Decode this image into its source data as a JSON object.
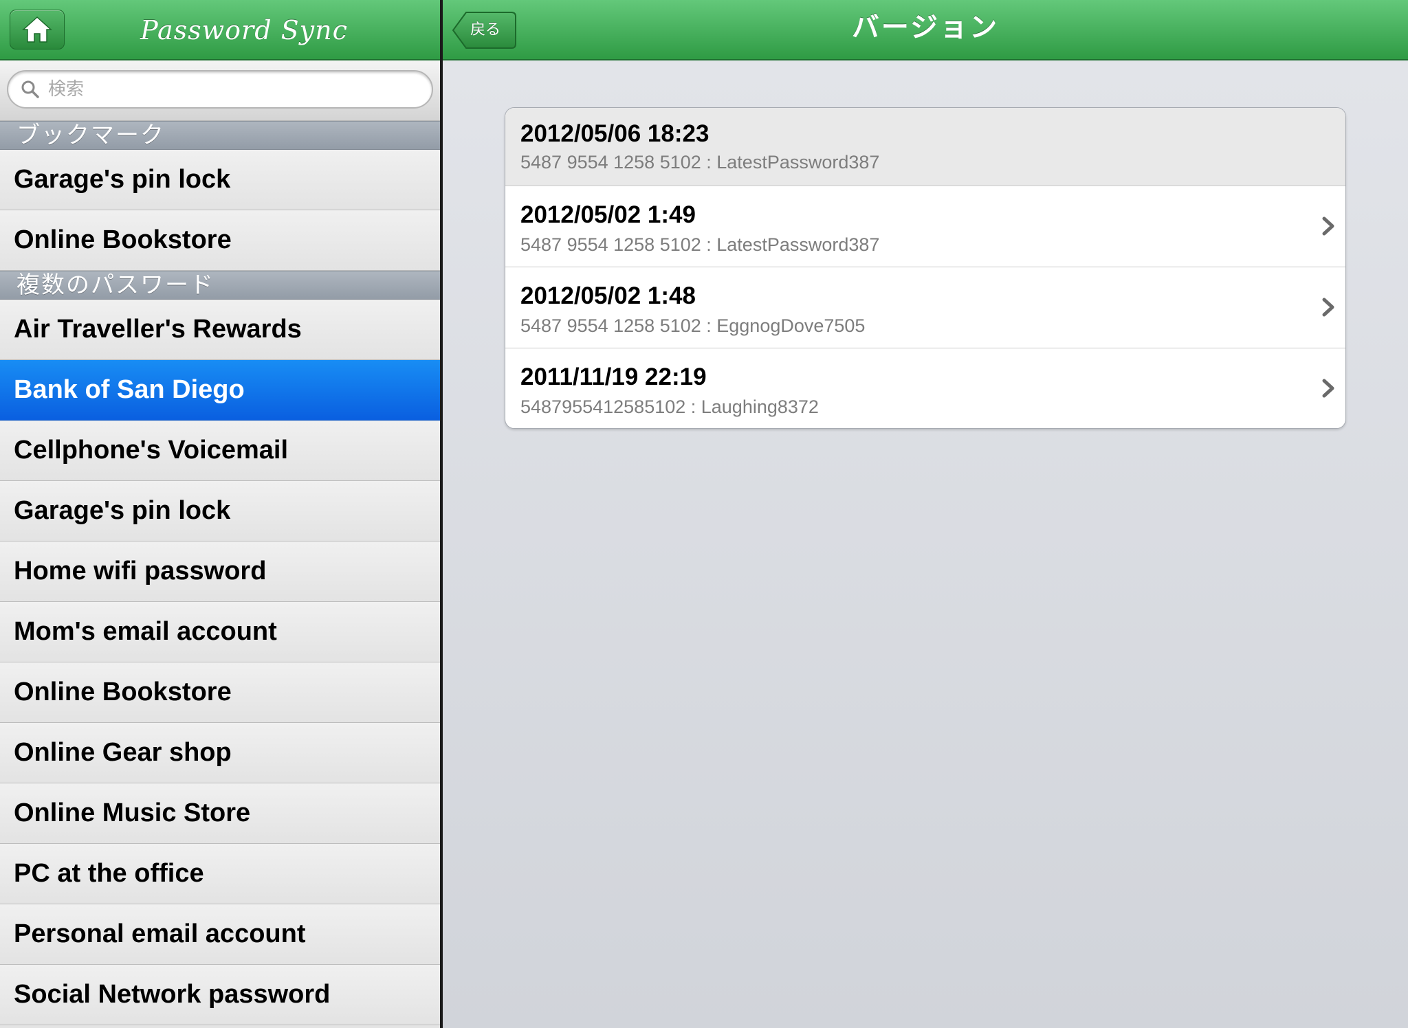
{
  "sidebar": {
    "title": "Password Sync",
    "search": {
      "placeholder": "検索",
      "value": ""
    },
    "sections": [
      {
        "header": "ブックマーク",
        "items": [
          "Garage's pin lock",
          "Online Bookstore"
        ]
      },
      {
        "header": "複数のパスワード",
        "items": [
          "Air Traveller's Rewards",
          "Bank of San Diego",
          "Cellphone's Voicemail",
          "Garage's pin lock",
          "Home wifi password",
          "Mom's email account",
          "Online Bookstore",
          "Online Gear shop",
          "Online Music Store",
          "PC at the office",
          "Personal email account",
          "Social Network password"
        ]
      }
    ],
    "selected_item": "Bank of San Diego"
  },
  "detail": {
    "back_label": "戻る",
    "title": "バージョン",
    "versions": [
      {
        "date": "2012/05/06 18:23",
        "detail": "5487 9554 1258 5102 : LatestPassword387",
        "current": true
      },
      {
        "date": "2012/05/02 1:49",
        "detail": "5487 9554 1258 5102 : LatestPassword387",
        "current": false
      },
      {
        "date": "2012/05/02 1:48",
        "detail": "5487 9554 1258 5102 : EggnogDove7505",
        "current": false
      },
      {
        "date": "2011/11/19 22:19",
        "detail": "5487955412585102 : Laughing8372",
        "current": false
      }
    ]
  },
  "colors": {
    "navbar_green": "#3fae56",
    "selection_blue": "#0f72ea",
    "section_header": "#a0a8b2"
  },
  "icons": [
    "home-icon",
    "search-icon",
    "back-arrow-icon",
    "chevron-right-icon"
  ]
}
